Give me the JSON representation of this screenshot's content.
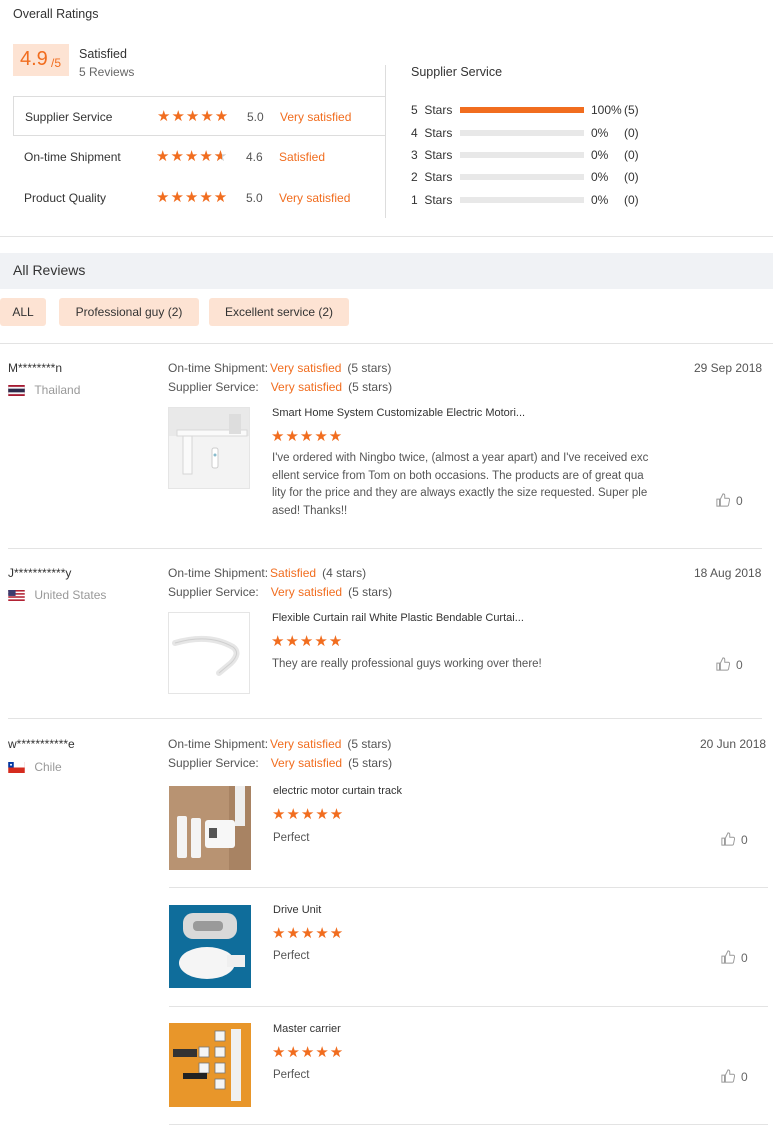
{
  "overall": {
    "title": "Overall Ratings",
    "score": "4.9",
    "score_of": "/5",
    "status": "Satisfied",
    "reviews_count": "5 Reviews",
    "rows": [
      {
        "label": "Supplier Service",
        "value": "5.0",
        "text": "Very satisfied",
        "stars": 5
      },
      {
        "label": "On-time Shipment",
        "value": "4.6",
        "text": "Satisfied",
        "stars": 4.6
      },
      {
        "label": "Product Quality",
        "value": "5.0",
        "text": "Very satisfied",
        "stars": 5
      }
    ]
  },
  "distribution": {
    "title": "Supplier Service",
    "rows": [
      {
        "label": "5  Stars",
        "pct": "100%",
        "count": "(5)",
        "fraction": 1.0
      },
      {
        "label": "4  Stars",
        "pct": "0%",
        "count": "(0)",
        "fraction": 0
      },
      {
        "label": "3  Stars",
        "pct": "0%",
        "count": "(0)",
        "fraction": 0
      },
      {
        "label": "2  Stars",
        "pct": "0%",
        "count": "(0)",
        "fraction": 0
      },
      {
        "label": "1  Stars",
        "pct": "0%",
        "count": "(0)",
        "fraction": 0
      }
    ]
  },
  "all_reviews": {
    "title": "All Reviews",
    "filters": [
      "ALL",
      "Professional guy (2)",
      "Excellent service (2)"
    ]
  },
  "labels": {
    "ontime": "On-time Shipment:",
    "supplier": "Supplier Service:"
  },
  "reviews": [
    {
      "user": "M********n",
      "country": "Thailand",
      "date": "29 Sep 2018",
      "ontime_text": "Very satisfied",
      "ontime_stars": "(5 stars)",
      "supplier_text": "Very satisfied",
      "supplier_stars": "(5 stars)",
      "items": [
        {
          "title": "Smart Home System Customizable Electric Motori...",
          "stars": 5,
          "text_lines": [
            "I've ordered with Ningbo twice, (almost a year apart) and I've received exc",
            "ellent service from Tom on both occasions. The products are of great qua",
            "lity for the price and they are always exactly the size requested. Super ple",
            "ased! Thanks!!"
          ],
          "likes": "0"
        }
      ]
    },
    {
      "user": "J***********y",
      "country": "United States",
      "date": "18 Aug 2018",
      "ontime_text": "Satisfied",
      "ontime_stars": "(4 stars)",
      "supplier_text": "Very satisfied",
      "supplier_stars": "(5 stars)",
      "items": [
        {
          "title": "Flexible Curtain rail White Plastic Bendable Curtai...",
          "stars": 5,
          "text_lines": [
            "They are really professional guys working over there!"
          ],
          "likes": "0"
        }
      ]
    },
    {
      "user": "w***********e",
      "country": "Chile",
      "date": "20 Jun 2018",
      "ontime_text": "Very satisfied",
      "ontime_stars": "(5 stars)",
      "supplier_text": "Very satisfied",
      "supplier_stars": "(5 stars)",
      "items": [
        {
          "title": "electric motor curtain track",
          "stars": 5,
          "text_lines": [
            "Perfect"
          ],
          "likes": "0"
        },
        {
          "title": "Drive Unit",
          "stars": 5,
          "text_lines": [
            "Perfect"
          ],
          "likes": "0"
        },
        {
          "title": "Master carrier",
          "stars": 5,
          "text_lines": [
            "Perfect"
          ],
          "likes": "0"
        }
      ]
    }
  ],
  "colors": {
    "accent": "#f16d1f",
    "accent_light": "#fde3d3"
  }
}
